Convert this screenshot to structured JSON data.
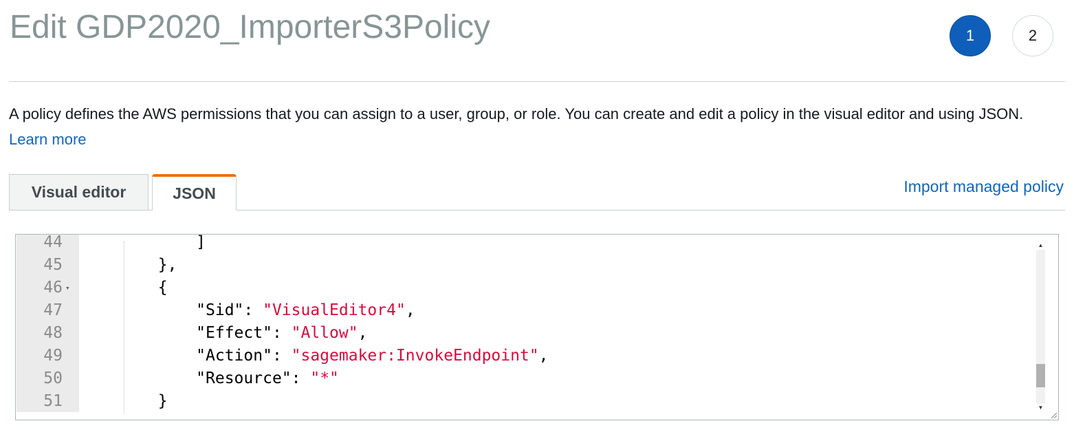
{
  "page": {
    "title": "Edit GDP2020_ImporterS3Policy",
    "steps": [
      "1",
      "2"
    ],
    "description": "A policy defines the AWS permissions that you can assign to a user, group, or role. You can create and edit a policy in the visual editor and using JSON.",
    "learn_more": "Learn more"
  },
  "tabs": {
    "visual_editor": "Visual editor",
    "json": "JSON",
    "active": "JSON",
    "import_link": "Import managed policy"
  },
  "editor": {
    "lines": [
      {
        "num": "44",
        "fold": "",
        "plain": "            ]",
        "str": "",
        "tail": ""
      },
      {
        "num": "45",
        "fold": "",
        "plain": "        },",
        "str": "",
        "tail": ""
      },
      {
        "num": "46",
        "fold": "▾",
        "plain": "        {",
        "str": "",
        "tail": ""
      },
      {
        "num": "47",
        "fold": "",
        "plain": "            \"Sid\": ",
        "str": "\"VisualEditor4\"",
        "tail": ","
      },
      {
        "num": "48",
        "fold": "",
        "plain": "            \"Effect\": ",
        "str": "\"Allow\"",
        "tail": ","
      },
      {
        "num": "49",
        "fold": "",
        "plain": "            \"Action\": ",
        "str": "\"sagemaker:InvokeEndpoint\"",
        "tail": ","
      },
      {
        "num": "50",
        "fold": "",
        "plain": "            \"Resource\": ",
        "str": "\"*\"",
        "tail": ""
      },
      {
        "num": "51",
        "fold": "",
        "plain": "        }",
        "str": "",
        "tail": ""
      }
    ],
    "scroll_up": "▲",
    "scroll_down": "▼"
  },
  "colors": {
    "primary_step": "#0f5fba",
    "tab_accent": "#ec7211",
    "link": "#1166bb",
    "json_string": "#d30d3d"
  }
}
